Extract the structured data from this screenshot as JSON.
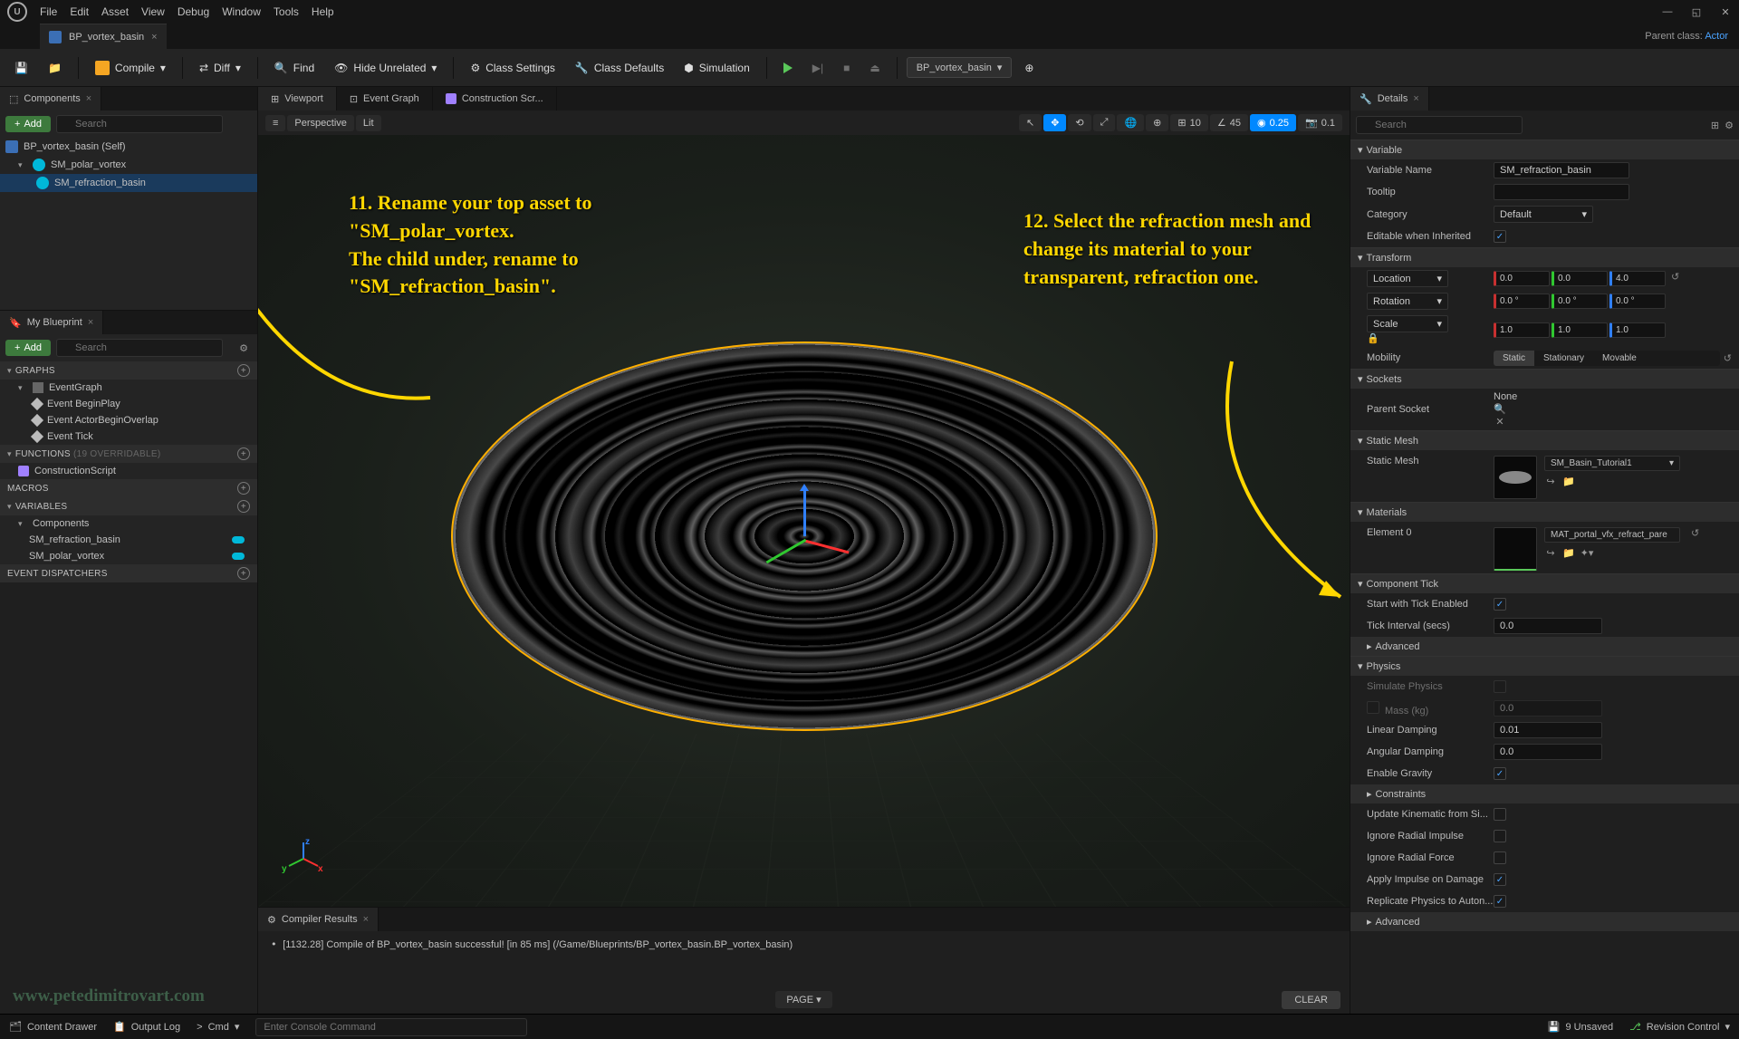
{
  "menubar": [
    "File",
    "Edit",
    "Asset",
    "View",
    "Debug",
    "Window",
    "Tools",
    "Help"
  ],
  "doc_tab": {
    "title": "BP_vortex_basin"
  },
  "parent_class": {
    "label": "Parent class:",
    "value": "Actor"
  },
  "toolbar": {
    "compile": "Compile",
    "diff": "Diff",
    "find": "Find",
    "hide_unrelated": "Hide Unrelated",
    "class_settings": "Class Settings",
    "class_defaults": "Class Defaults",
    "simulation": "Simulation",
    "bp_selector": "BP_vortex_basin"
  },
  "components": {
    "tab_label": "Components",
    "add": "Add",
    "search_placeholder": "Search",
    "tree": [
      {
        "label": "BP_vortex_basin (Self)",
        "indent": 0,
        "type": "bp"
      },
      {
        "label": "SM_polar_vortex",
        "indent": 1,
        "type": "mesh"
      },
      {
        "label": "SM_refraction_basin",
        "indent": 2,
        "type": "mesh",
        "selected": true
      }
    ]
  },
  "myblueprint": {
    "tab_label": "My Blueprint",
    "add": "Add",
    "search_placeholder": "Search",
    "sections": {
      "graphs": {
        "title": "GRAPHS",
        "items": [
          "EventGraph"
        ],
        "events": [
          "Event BeginPlay",
          "Event ActorBeginOverlap",
          "Event Tick"
        ]
      },
      "functions": {
        "title": "FUNCTIONS",
        "suffix": "(19 OVERRIDABLE)",
        "items": [
          "ConstructionScript"
        ]
      },
      "macros": {
        "title": "MACROS"
      },
      "variables": {
        "title": "VARIABLES",
        "group": "Components",
        "items": [
          "SM_refraction_basin",
          "SM_polar_vortex"
        ]
      },
      "dispatchers": {
        "title": "EVENT DISPATCHERS"
      }
    }
  },
  "center_tabs": [
    "Viewport",
    "Event Graph",
    "Construction Scr..."
  ],
  "viewport_toolbar": {
    "perspective": "Perspective",
    "lit": "Lit",
    "grid_val": "10",
    "angle_val": "45",
    "scale_val": "0.25",
    "cam_val": "0.1"
  },
  "annotations": {
    "a11": "11. Rename your top asset to \"SM_polar_vortex.\nThe child under, rename to \"SM_refraction_basin\".",
    "a12": "12. Select the refraction mesh and change its material to your transparent, refraction one."
  },
  "compiler": {
    "tab": "Compiler Results",
    "message": "[1132.28] Compile of BP_vortex_basin successful! [in 85 ms] (/Game/Blueprints/BP_vortex_basin.BP_vortex_basin)",
    "page_btn": "PAGE",
    "clear_btn": "CLEAR"
  },
  "details": {
    "tab_label": "Details",
    "search_placeholder": "Search",
    "variable": {
      "title": "Variable",
      "name_label": "Variable Name",
      "name_value": "SM_refraction_basin",
      "tooltip_label": "Tooltip",
      "tooltip_value": "",
      "category_label": "Category",
      "category_value": "Default",
      "editable_label": "Editable when Inherited",
      "editable_checked": true
    },
    "transform": {
      "title": "Transform",
      "location_label": "Location",
      "location": [
        "0.0",
        "0.0",
        "4.0"
      ],
      "rotation_label": "Rotation",
      "rotation": [
        "0.0 °",
        "0.0 °",
        "0.0 °"
      ],
      "scale_label": "Scale",
      "scale": [
        "1.0",
        "1.0",
        "1.0"
      ],
      "mobility_label": "Mobility",
      "mobility_opts": [
        "Static",
        "Stationary",
        "Movable"
      ],
      "mobility_active": "Static"
    },
    "sockets": {
      "title": "Sockets",
      "parent_label": "Parent Socket",
      "parent_value": "None"
    },
    "static_mesh": {
      "title": "Static Mesh",
      "label": "Static Mesh",
      "value": "SM_Basin_Tutorial1"
    },
    "materials": {
      "title": "Materials",
      "element_label": "Element 0",
      "element_value": "MAT_portal_vfx_refract_pare"
    },
    "component_tick": {
      "title": "Component Tick",
      "start_label": "Start with Tick Enabled",
      "start_checked": true,
      "interval_label": "Tick Interval (secs)",
      "interval_value": "0.0",
      "advanced": "Advanced"
    },
    "physics": {
      "title": "Physics",
      "simulate_label": "Simulate Physics",
      "simulate_checked": false,
      "mass_label": "Mass (kg)",
      "mass_value": "0.0",
      "linear_label": "Linear Damping",
      "linear_value": "0.01",
      "angular_label": "Angular Damping",
      "angular_value": "0.0",
      "gravity_label": "Enable Gravity",
      "gravity_checked": true,
      "constraints": "Constraints",
      "update_kin_label": "Update Kinematic from Si...",
      "ignore_impulse_label": "Ignore Radial Impulse",
      "ignore_force_label": "Ignore Radial Force",
      "apply_impulse_label": "Apply Impulse on Damage",
      "apply_impulse_checked": true,
      "replicate_label": "Replicate Physics to Auton...",
      "replicate_checked": true,
      "advanced": "Advanced"
    }
  },
  "statusbar": {
    "content_drawer": "Content Drawer",
    "output_log": "Output Log",
    "cmd_label": "Cmd",
    "cmd_placeholder": "Enter Console Command",
    "unsaved": "9 Unsaved",
    "revision": "Revision Control"
  },
  "watermark": "www.petedimitrovart.com"
}
